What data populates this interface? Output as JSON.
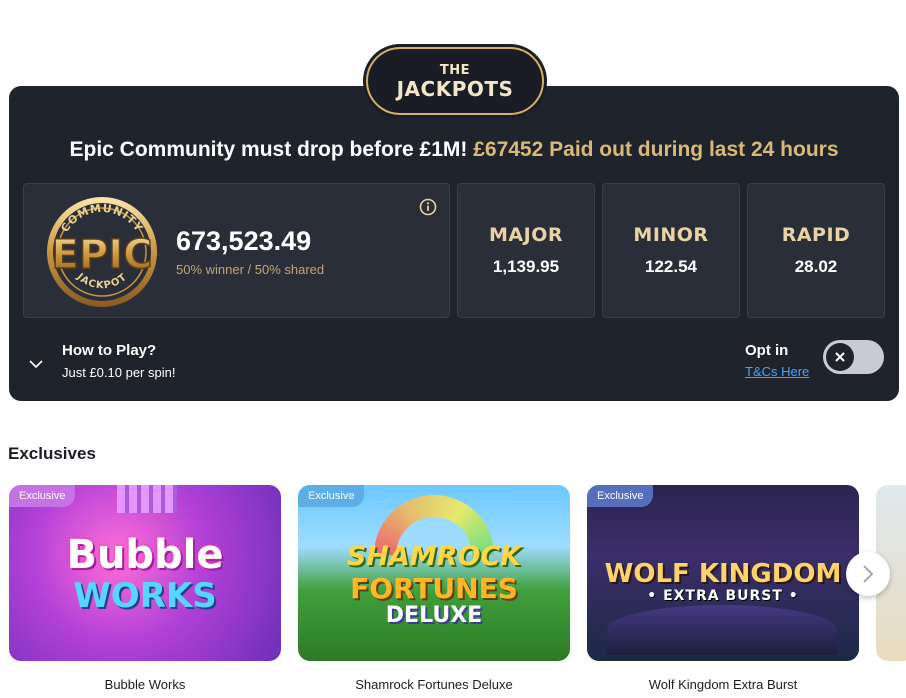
{
  "badge": {
    "line1": "THE",
    "line2": "JACKPOTS"
  },
  "headline": {
    "white": "Epic Community must drop before £1M!",
    "gold": "£67452 Paid out during last 24 hours"
  },
  "epic": {
    "logo_text": "EPIC",
    "logo_top": "COMMUNITY",
    "logo_bottom": "JACKPOT",
    "amount": "673,523.49",
    "share_text": "50% winner / 50% shared"
  },
  "tiers": [
    {
      "name": "MAJOR",
      "value": "1,139.95"
    },
    {
      "name": "MINOR",
      "value": "122.54"
    },
    {
      "name": "RAPID",
      "value": "28.02"
    }
  ],
  "how_to_play": {
    "title": "How to Play?",
    "subtitle": "Just £0.10 per spin!"
  },
  "opt_in": {
    "label": "Opt in",
    "link": "T&Cs Here",
    "enabled": false
  },
  "exclusives": {
    "title": "Exclusives",
    "cards": [
      {
        "tag": "Exclusive",
        "art_line1": "Bubble",
        "art_line2": "WORKS",
        "label": "Bubble Works"
      },
      {
        "tag": "Exclusive",
        "art_line1": "SHAMROCK",
        "art_line2": "FORTUNES",
        "art_line3": "DELUXE",
        "label": "Shamrock Fortunes Deluxe"
      },
      {
        "tag": "Exclusive",
        "art_line1": "WOLF KINGDOM",
        "art_line2": "• EXTRA BURST •",
        "label": "Wolf Kingdom Extra Burst"
      }
    ]
  },
  "colors": {
    "panel_bg": "#1f232c",
    "tile_bg": "#2a2e38",
    "gold": "#d9b878",
    "link": "#4aa3ff"
  }
}
